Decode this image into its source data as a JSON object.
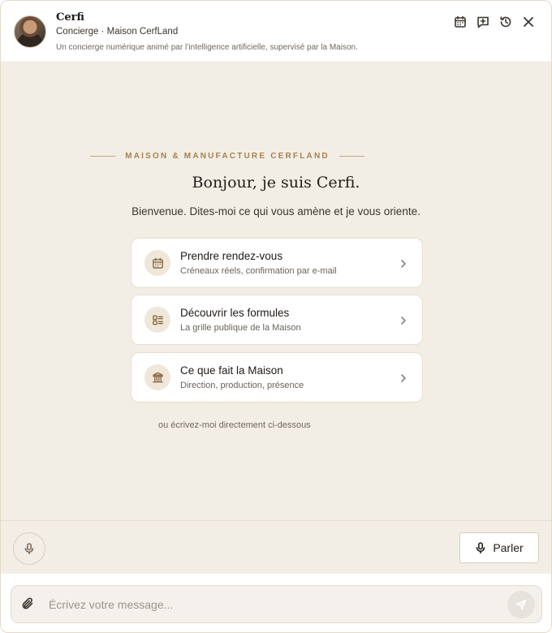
{
  "header": {
    "name": "Cerfi",
    "subtitle": "Concierge · Maison CerfLand",
    "tagline": "Un concierge numérique animé par l’intelligence artificielle, supervisé par la Maison.",
    "icons": [
      "calendar-icon",
      "new-chat-icon",
      "history-icon",
      "close-icon"
    ]
  },
  "welcome": {
    "eyebrow": "MAISON & MANUFACTURE CERFLAND",
    "greeting": "Bonjour, je suis Cerfi.",
    "intro": "Bienvenue. Dites-moi ce qui vous amène et je vous oriente."
  },
  "cards": [
    {
      "title": "Prendre rendez-vous",
      "subtitle": "Créneaux réels, confirmation par e-mail",
      "icon": "calendar-icon"
    },
    {
      "title": "Découvrir les formules",
      "subtitle": "La grille publique de la Maison",
      "icon": "list-icon"
    },
    {
      "title": "Ce que fait la Maison",
      "subtitle": "Direction, production, présence",
      "icon": "institution-icon"
    }
  ],
  "hint": "ou écrivez-moi directement ci-dessous",
  "voice": {
    "speak_label": "Parler"
  },
  "composer": {
    "placeholder": "Écrivez votre message..."
  },
  "colors": {
    "accent": "#a6824f",
    "background": "#f2eee6",
    "card": "#ffffff"
  }
}
